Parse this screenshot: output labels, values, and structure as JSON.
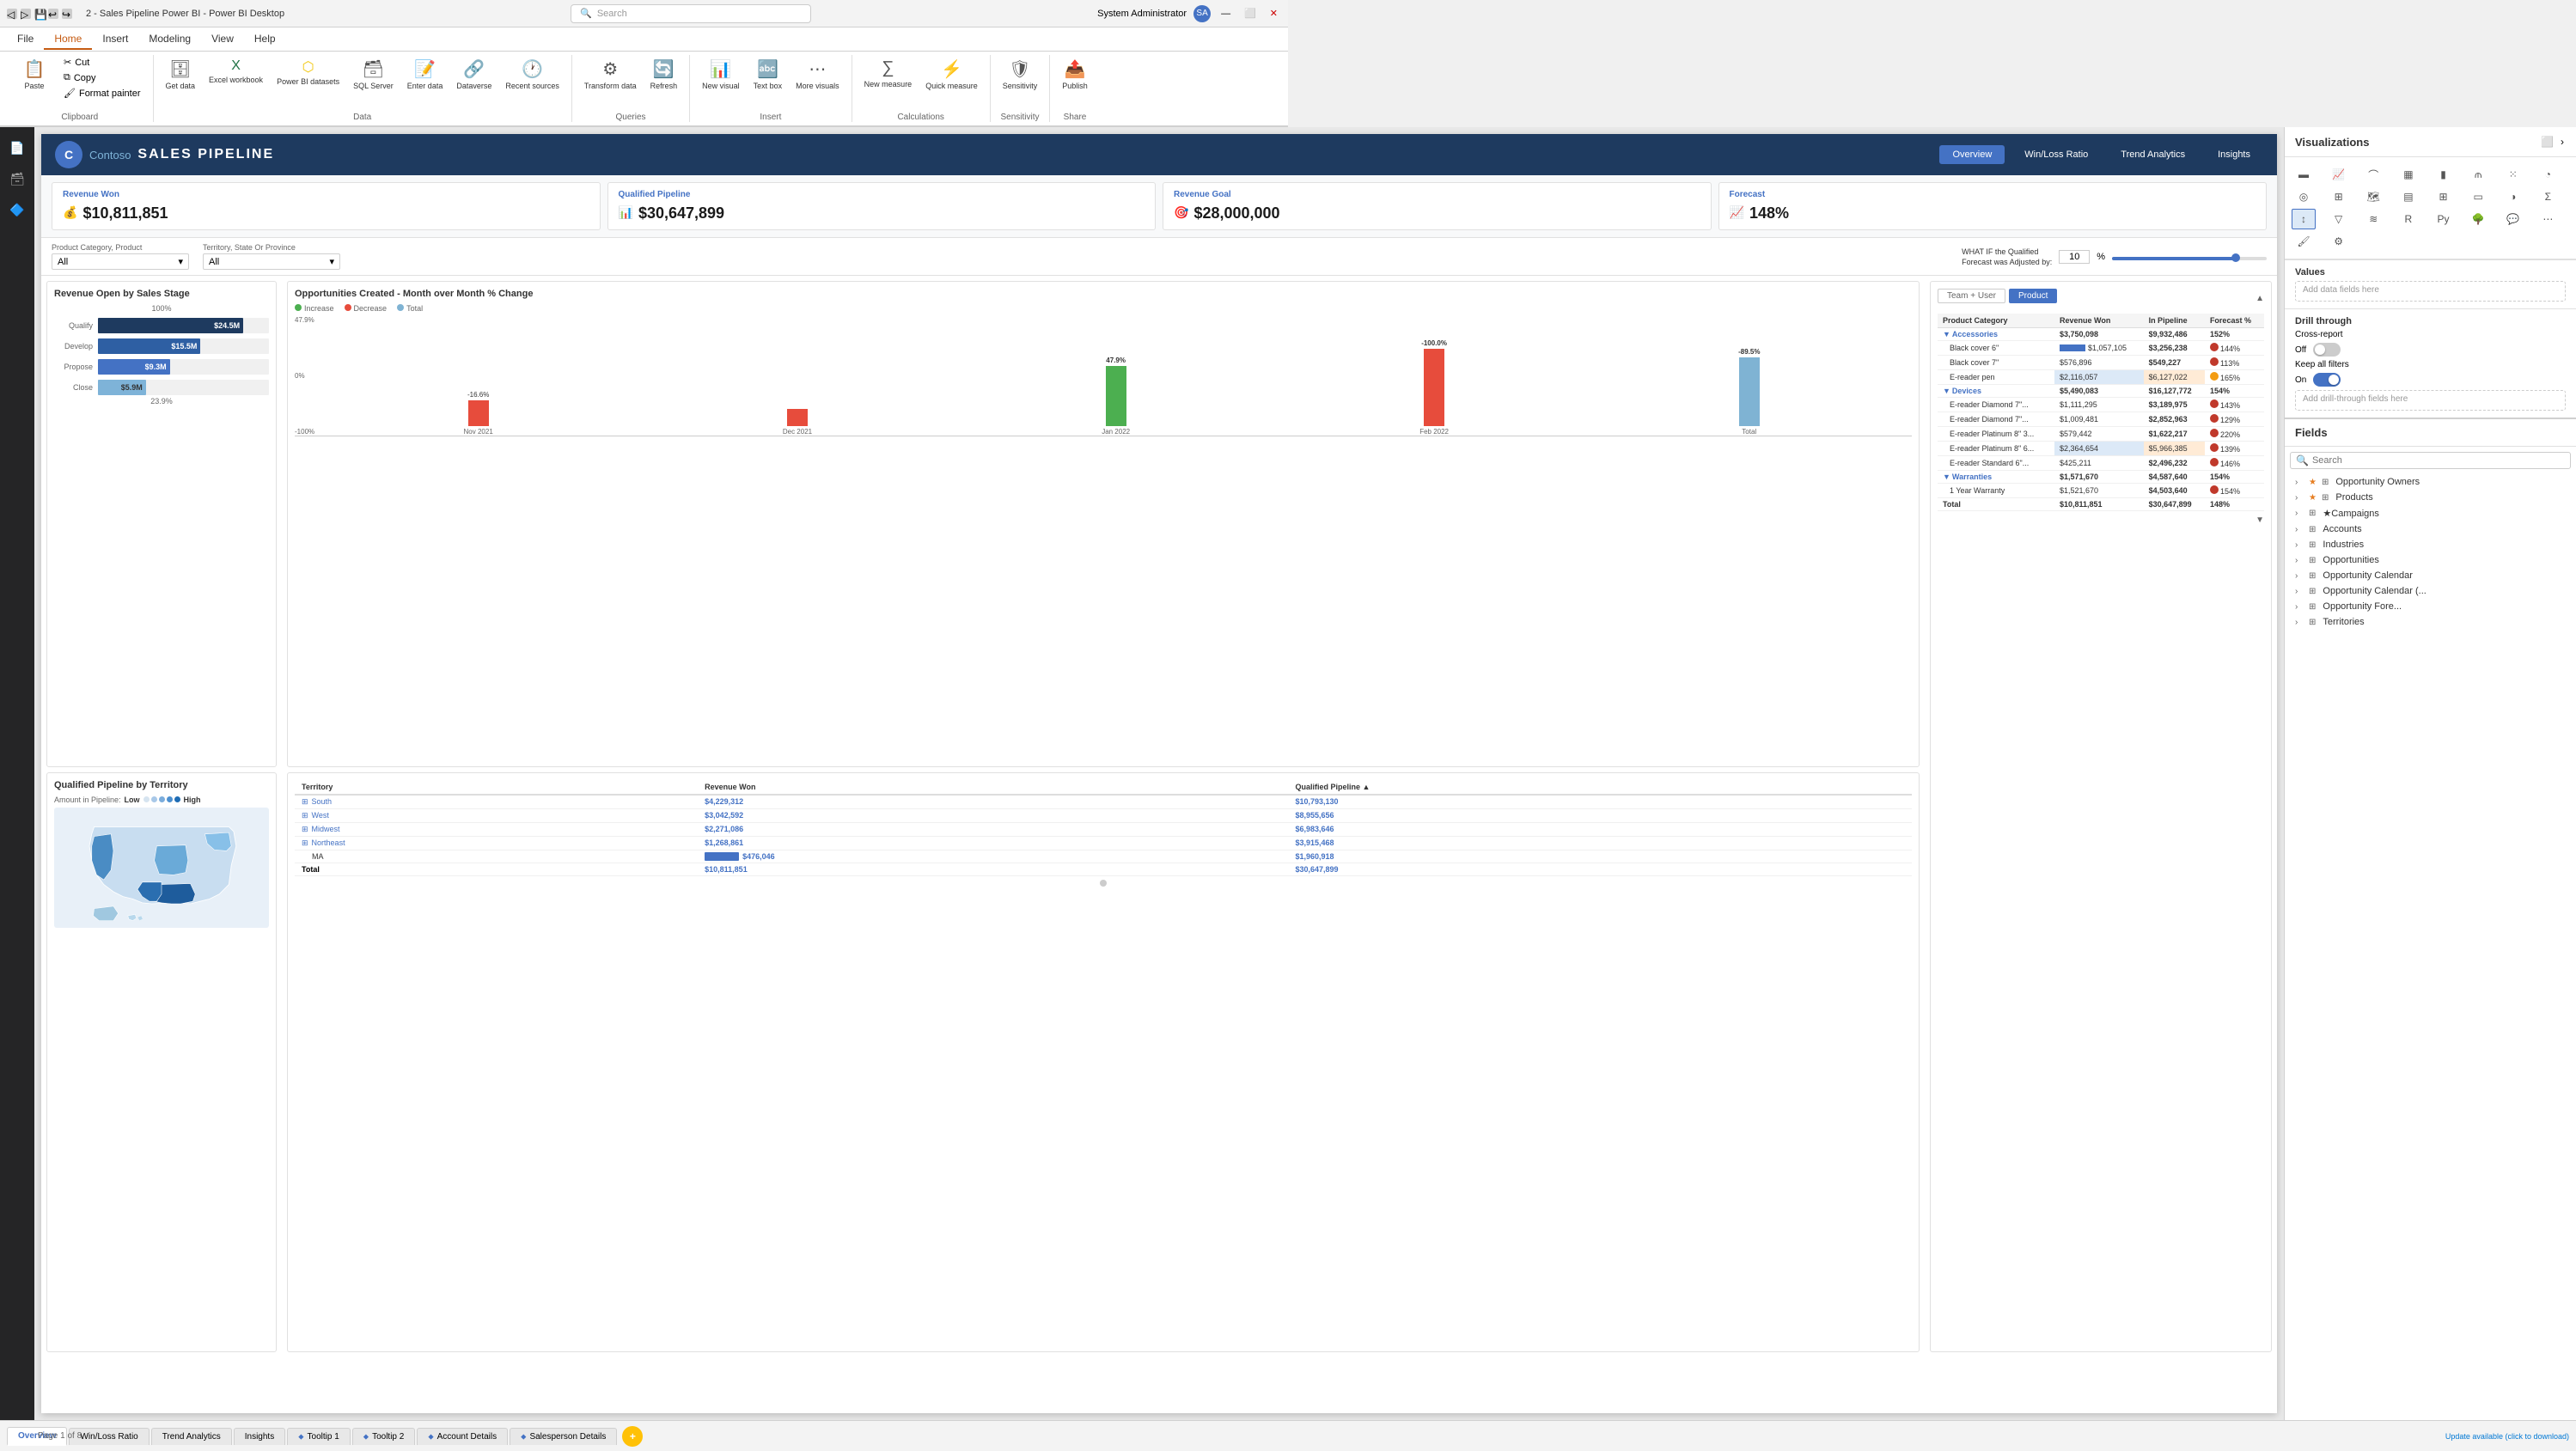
{
  "window": {
    "title": "2 - Sales Pipeline Power BI - Power BI Desktop",
    "search_placeholder": "Search"
  },
  "user": "System Administrator",
  "ribbon_tabs": [
    "File",
    "Home",
    "Insert",
    "Modeling",
    "View",
    "Help"
  ],
  "active_tab": "Home",
  "ribbon": {
    "clipboard_group": "Clipboard",
    "data_group": "Data",
    "queries_group": "Queries",
    "insert_group": "Insert",
    "calculations_group": "Calculations",
    "sensitivity_group": "Sensitivity",
    "share_group": "Share",
    "buttons": {
      "paste": "Paste",
      "cut": "Cut",
      "copy": "Copy",
      "format_painter": "Format painter",
      "get_data": "Get data",
      "excel_workbook": "Excel workbook",
      "power_bi_datasets": "Power BI datasets",
      "sql_server": "SQL Server",
      "enter_data": "Enter data",
      "dataverse": "Dataverse",
      "recent_sources": "Recent sources",
      "transform_data": "Transform data",
      "refresh": "Refresh",
      "new_visual": "New visual",
      "text_box": "Text box",
      "more_visuals": "More visuals",
      "new_measure": "New measure",
      "quick_measure": "Quick measure",
      "sensitivity": "Sensitivity",
      "publish": "Publish"
    }
  },
  "report": {
    "brand": "C",
    "brand_name": "Contoso",
    "title": "SALES PIPELINE",
    "nav_buttons": [
      "Overview",
      "Win/Loss Ratio",
      "Trend Analytics",
      "Insights"
    ],
    "active_nav": "Overview"
  },
  "kpis": [
    {
      "label": "Revenue Won",
      "value": "$10,811,851",
      "icon": "💰"
    },
    {
      "label": "Qualified Pipeline",
      "value": "$30,647,899",
      "icon": "📊"
    },
    {
      "label": "Revenue Goal",
      "value": "$28,000,000",
      "icon": "🎯"
    },
    {
      "label": "Forecast",
      "value": "148%",
      "icon": "📈"
    }
  ],
  "filters": {
    "product_label": "Product Category, Product",
    "product_value": "All",
    "territory_label": "Territory, State Or Province",
    "territory_value": "All",
    "whatif_label": "WHAT IF the Qualified Forecast was Adjusted by:",
    "whatif_value": "10",
    "whatif_unit": "%"
  },
  "revenue_chart": {
    "title": "Revenue Open by Sales Stage",
    "bars": [
      {
        "label": "Qualify",
        "value": "$24.5M",
        "pct": 85
      },
      {
        "label": "Develop",
        "value": "$15.5M",
        "pct": 60
      },
      {
        "label": "Propose",
        "value": "$9.3M",
        "pct": 42
      },
      {
        "label": "Close",
        "value": "$5.9M",
        "pct": 28
      }
    ],
    "top_label": "100%",
    "bottom_label": "23.9%"
  },
  "waterfall_chart": {
    "title": "Opportunities Created - Month over Month % Change",
    "legend": [
      "Increase",
      "Decrease",
      "Total"
    ],
    "bars": [
      {
        "label": "Nov 2021",
        "value": 0,
        "type": "base"
      },
      {
        "label": "Dec 2021",
        "value": -16.6,
        "type": "decrease"
      },
      {
        "label": "Jan 2022",
        "value": 47.9,
        "type": "increase"
      },
      {
        "label": "Feb 2022",
        "value": -100.0,
        "type": "decrease"
      },
      {
        "label": "Total",
        "value": -89.5,
        "type": "total"
      }
    ]
  },
  "product_table": {
    "title": "Product Category",
    "tabs": [
      "Team + User",
      "Product"
    ],
    "active_tab": "Product",
    "columns": [
      "Product Category",
      "Revenue Won",
      "In Pipeline",
      "Forecast %"
    ],
    "rows": [
      {
        "name": "Accessories",
        "revenue": "$3,750,098",
        "pipeline": "$9,932,486",
        "forecast": "152%",
        "level": 0,
        "indicator": "none"
      },
      {
        "name": "Black cover 6\"",
        "revenue": "$1,057,105",
        "pipeline": "$3,256,238",
        "forecast": "144%",
        "level": 1,
        "indicator": "red"
      },
      {
        "name": "Black cover 7\"",
        "revenue": "$576,896",
        "pipeline": "$549,227",
        "forecast": "113%",
        "level": 1,
        "indicator": "red"
      },
      {
        "name": "E-reader pen",
        "revenue": "$2,116,057",
        "pipeline": "$6,127,022",
        "forecast": "165%",
        "level": 1,
        "indicator": "yellow"
      },
      {
        "name": "Devices",
        "revenue": "$5,490,083",
        "pipeline": "$16,127,772",
        "forecast": "154%",
        "level": 0,
        "indicator": "none"
      },
      {
        "name": "E-reader Diamond 7\"...",
        "revenue": "$1,111,295",
        "pipeline": "$3,189,975",
        "forecast": "143%",
        "level": 1,
        "indicator": "red"
      },
      {
        "name": "E-reader Diamond 7\"...",
        "revenue": "$1,009,481",
        "pipeline": "$2,852,963",
        "forecast": "129%",
        "level": 1,
        "indicator": "red"
      },
      {
        "name": "E-reader Platinum 8\" 3...",
        "revenue": "$579,442",
        "pipeline": "$1,622,217",
        "forecast": "220%",
        "level": 1,
        "indicator": "red"
      },
      {
        "name": "E-reader Platinum 8\" 6...",
        "revenue": "$2,364,654",
        "pipeline": "$5,966,385",
        "forecast": "139%",
        "level": 1,
        "indicator": "red"
      },
      {
        "name": "E-reader Standard 6\"...",
        "revenue": "$425,211",
        "pipeline": "$2,496,232",
        "forecast": "146%",
        "level": 1,
        "indicator": "red"
      },
      {
        "name": "Warranties",
        "revenue": "$1,571,670",
        "pipeline": "$4,587,640",
        "forecast": "154%",
        "level": 0,
        "indicator": "none"
      },
      {
        "name": "1 Year Warranty",
        "revenue": "$1,521,670",
        "pipeline": "$4,503,640",
        "forecast": "154%",
        "level": 1,
        "indicator": "red"
      }
    ],
    "total_row": {
      "label": "Total",
      "revenue": "$10,811,851",
      "pipeline": "$30,647,899",
      "forecast": "148%"
    }
  },
  "map_chart": {
    "title": "Qualified Pipeline by Territory",
    "legend_label_low": "Low",
    "legend_label_high": "High",
    "amount_label": "Amount in Pipeline:"
  },
  "territory_table": {
    "columns": [
      "Territory",
      "Revenue Won",
      "Qualified Pipeline"
    ],
    "rows": [
      {
        "name": "South",
        "revenue": "$4,229,312",
        "pipeline": "$10,793,130"
      },
      {
        "name": "West",
        "revenue": "$3,042,592",
        "pipeline": "$8,955,656"
      },
      {
        "name": "Midwest",
        "revenue": "$2,271,086",
        "pipeline": "$6,983,646"
      },
      {
        "name": "Northeast",
        "revenue": "$1,268,861",
        "pipeline": "$3,915,468"
      },
      {
        "name": "MA",
        "revenue": "$476,046",
        "pipeline": "$1,960,918"
      }
    ],
    "total": {
      "label": "Total",
      "revenue": "$10,811,851",
      "pipeline": "$30,647,899"
    }
  },
  "visualizations_panel": {
    "title": "Visualizations",
    "viz_icons": [
      "📊",
      "📈",
      "📉",
      "🗃",
      "💡",
      "🗺",
      "⬛",
      "🔷",
      "⭕",
      "📋",
      "🌳",
      "💧",
      "🎯",
      "📐",
      "📌",
      "🔵"
    ],
    "values_section": "Values",
    "values_placeholder": "Add data fields here",
    "drill_through_title": "Drill through",
    "cross_report_label": "Cross-report",
    "cross_report_state": "Off",
    "keep_all_filters_label": "Keep all filters",
    "keep_all_filters_state": "On",
    "drill_placeholder": "Add drill-through fields here"
  },
  "fields_panel": {
    "title": "Fields",
    "search_placeholder": "Search",
    "items": [
      {
        "name": "Opportunity Owners",
        "type": "table",
        "expanded": false
      },
      {
        "name": "Products",
        "type": "table",
        "expanded": false
      },
      {
        "name": "Campaigns",
        "type": "table",
        "expanded": false
      },
      {
        "name": "Accounts",
        "type": "table",
        "expanded": false
      },
      {
        "name": "Industries",
        "type": "table",
        "expanded": false
      },
      {
        "name": "Opportunities",
        "type": "table",
        "expanded": false
      },
      {
        "name": "Opportunity Calendar",
        "type": "table",
        "expanded": false
      },
      {
        "name": "Opportunity Calendar (",
        "type": "table",
        "expanded": false
      },
      {
        "name": "Opportunity Fore...",
        "type": "table",
        "expanded": false
      },
      {
        "name": "Territories",
        "type": "table",
        "expanded": false
      }
    ]
  },
  "bottom_tabs": [
    "Overview",
    "Win/Loss Ratio",
    "Trend Analytics",
    "Insights",
    "Tooltip 1",
    "Tooltip 2",
    "Account Details",
    "Salesperson Details"
  ],
  "active_bottom_tab": "Overview",
  "page_indicator": "Page 1 of 8",
  "status_bar": "Update available (click to download)"
}
